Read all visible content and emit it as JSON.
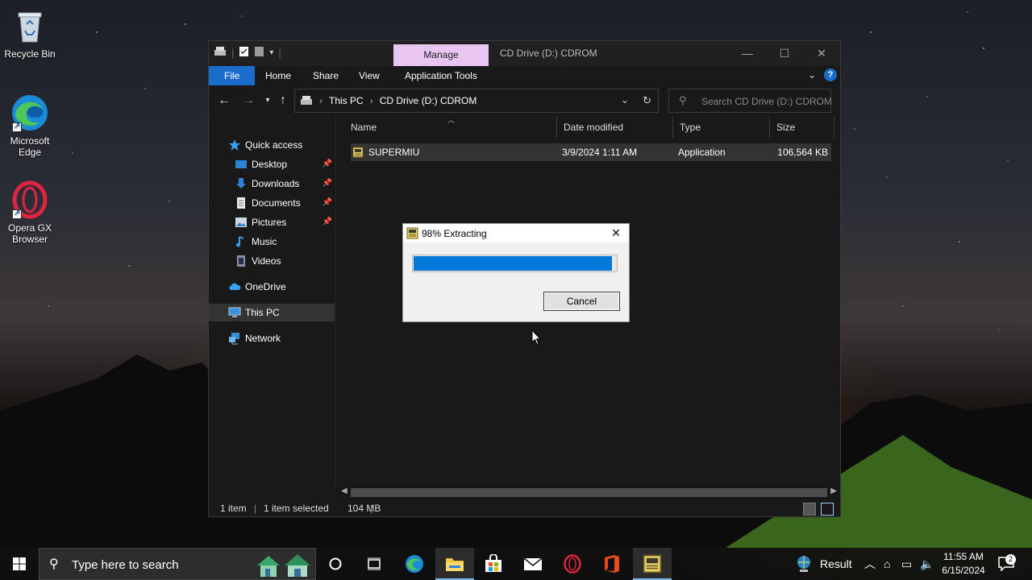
{
  "desktop": {
    "icons": [
      {
        "label": "Recycle Bin"
      },
      {
        "label": "Microsoft Edge"
      },
      {
        "label": "Opera GX Browser"
      }
    ]
  },
  "window": {
    "title": "CD Drive (D:) CDROM",
    "manage_tab": "Manage",
    "ribbon_tabs": [
      "File",
      "Home",
      "Share",
      "View",
      "Application Tools"
    ],
    "help_label": "?",
    "address": {
      "crumbs": [
        "This PC",
        "CD Drive (D:) CDROM"
      ]
    },
    "search_placeholder": "Search CD Drive (D:) CDROM",
    "nav": {
      "quick_access": "Quick access",
      "items": [
        "Desktop",
        "Downloads",
        "Documents",
        "Pictures",
        "Music",
        "Videos"
      ],
      "onedrive": "OneDrive",
      "this_pc": "This PC",
      "network": "Network"
    },
    "columns": [
      "Name",
      "Date modified",
      "Type",
      "Size"
    ],
    "files": [
      {
        "name": "SUPERMIU",
        "date": "3/9/2024 1:11 AM",
        "type": "Application",
        "size": "106,564 KB"
      }
    ],
    "status": {
      "count": "1 item",
      "selected": "1 item selected",
      "size": "104 MB"
    }
  },
  "dialog": {
    "title": "98% Extracting",
    "progress": 0.98,
    "cancel_label": "Cancel"
  },
  "taskbar": {
    "search_placeholder": "Type here to search",
    "tray_label": "Result",
    "time": "11:55 AM",
    "date": "6/15/2024",
    "notification_count": "2"
  },
  "colors": {
    "accent": "#0078d7",
    "ribbon_file": "#1a6dcb",
    "manage_tab": "#e7c6f2",
    "window_bg": "#191919"
  }
}
